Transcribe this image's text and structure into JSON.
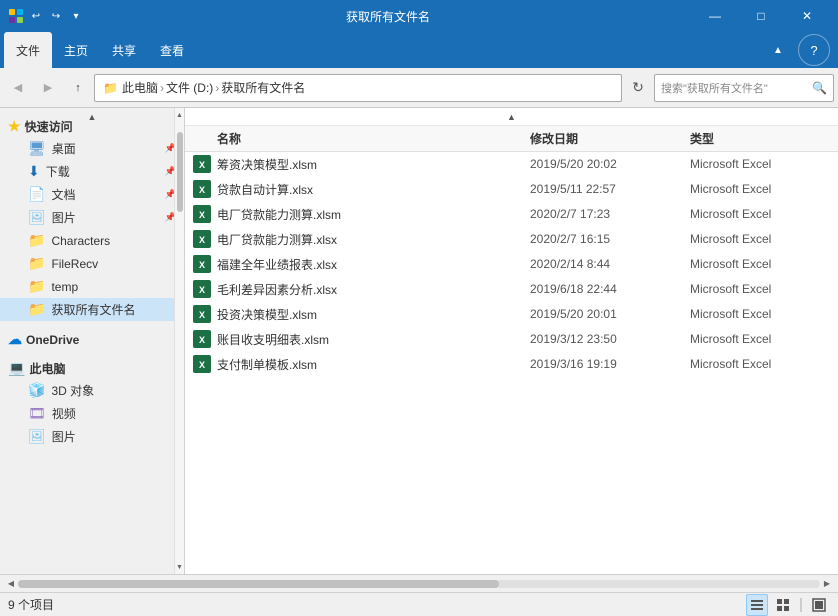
{
  "titleBar": {
    "title": "获取所有文件名",
    "minimizeLabel": "—",
    "maximizeLabel": "□",
    "closeLabel": "✕"
  },
  "ribbon": {
    "tabs": [
      "文件",
      "主页",
      "共享",
      "查看"
    ]
  },
  "addressBar": {
    "backTooltip": "后退",
    "forwardTooltip": "前进",
    "upTooltip": "向上",
    "path": [
      "此电脑",
      "文件 (D:)",
      "获取所有文件名"
    ],
    "searchPlaceholder": "搜索\"获取所有文件名\"",
    "searchText": ""
  },
  "sidebar": {
    "sections": [
      {
        "label": "快速访问",
        "icon": "star",
        "items": [
          {
            "label": "桌面",
            "icon": "desktop",
            "pinned": true
          },
          {
            "label": "下载",
            "icon": "download",
            "pinned": true
          },
          {
            "label": "文档",
            "icon": "document",
            "pinned": true
          },
          {
            "label": "图片",
            "icon": "picture",
            "pinned": true
          },
          {
            "label": "Characters",
            "icon": "folder",
            "pinned": false
          },
          {
            "label": "FileRecv",
            "icon": "folder",
            "pinned": false
          },
          {
            "label": "temp",
            "icon": "folder",
            "pinned": false
          },
          {
            "label": "获取所有文件名",
            "icon": "folder",
            "pinned": false
          }
        ]
      },
      {
        "label": "OneDrive",
        "icon": "cloud",
        "items": []
      },
      {
        "label": "此电脑",
        "icon": "computer",
        "items": [
          {
            "label": "3D 对象",
            "icon": "3d"
          },
          {
            "label": "视频",
            "icon": "video"
          },
          {
            "label": "图片",
            "icon": "picture2"
          }
        ]
      }
    ]
  },
  "fileList": {
    "headers": [
      "名称",
      "修改日期",
      "类型"
    ],
    "files": [
      {
        "name": "筹资决策模型.xlsm",
        "date": "2019/5/20 20:02",
        "type": "Microsoft Excel",
        "ext": "xlsm"
      },
      {
        "name": "贷款自动计算.xlsx",
        "date": "2019/5/11 22:57",
        "type": "Microsoft Excel",
        "ext": "xlsx"
      },
      {
        "name": "电厂贷款能力测算.xlsm",
        "date": "2020/2/7 17:23",
        "type": "Microsoft Excel",
        "ext": "xlsm"
      },
      {
        "name": "电厂贷款能力测算.xlsx",
        "date": "2020/2/7 16:15",
        "type": "Microsoft Excel",
        "ext": "xlsx"
      },
      {
        "name": "福建全年业绩报表.xlsx",
        "date": "2020/2/14 8:44",
        "type": "Microsoft Excel",
        "ext": "xlsx"
      },
      {
        "name": "毛利差异因素分析.xlsx",
        "date": "2019/6/18 22:44",
        "type": "Microsoft Excel",
        "ext": "xlsx"
      },
      {
        "name": "投资决策模型.xlsm",
        "date": "2019/5/20 20:01",
        "type": "Microsoft Excel",
        "ext": "xlsm"
      },
      {
        "name": "账目收支明细表.xlsm",
        "date": "2019/3/12 23:50",
        "type": "Microsoft Excel",
        "ext": "xlsm"
      },
      {
        "name": "支付制单模板.xlsm",
        "date": "2019/3/16 19:19",
        "type": "Microsoft Excel",
        "ext": "xlsm"
      }
    ]
  },
  "statusBar": {
    "itemCount": "9 个项目",
    "viewListLabel": "≡",
    "viewGridLabel": "⊞",
    "viewLargeLabel": "⊟"
  }
}
